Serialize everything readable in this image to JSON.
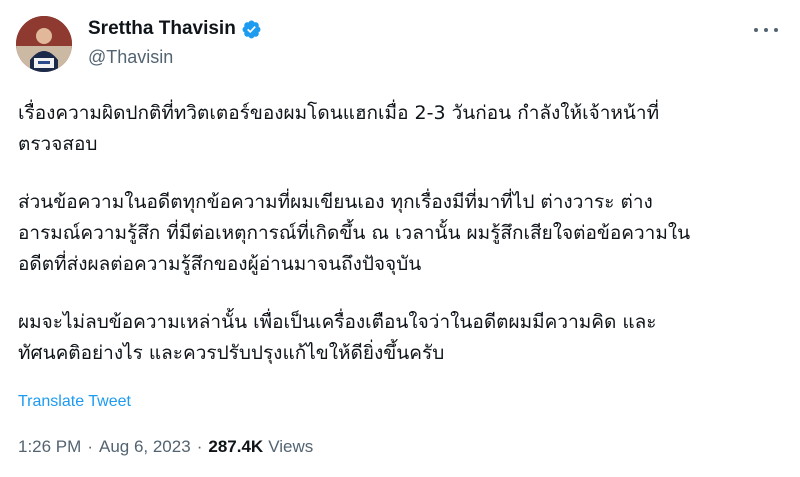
{
  "author": {
    "name": "Srettha Thavisin",
    "handle": "@Thavisin",
    "verified": true,
    "avatar_colors": {
      "top": "#7a2b2b",
      "bottom": "#d8c9b8"
    }
  },
  "more_icon": "more-horizontal-icon",
  "paragraphs": [
    {
      "lines": [
        "เรื่องความผิดปกติที่ทวิตเตอร์ของผมโดนแฮกเมื่อ 2-3 วันก่อน กำลังให้เจ้าหน้าที่",
        "ตรวจสอบ"
      ]
    },
    {
      "lines": [
        "ส่วนข้อความในอดีตทุกข้อความที่ผมเขียนเอง ทุกเรื่องมีที่มาที่ไป ต่างวาระ ต่าง",
        "อารมณ์ความรู้สึก ที่มีต่อเหตุการณ์ที่เกิดขึ้น ณ เวลานั้น ผมรู้สึกเสียใจต่อข้อความใน",
        "อดีตที่ส่งผลต่อความรู้สึกของผู้อ่านมาจนถึงปัจจุบัน"
      ]
    },
    {
      "lines": [
        "ผมจะไม่ลบข้อความเหล่านั้น เพื่อเป็นเครื่องเตือนใจว่าในอดีตผมมีความคิด และ",
        "ทัศนคติอย่างไร และควรปรับปรุงแก้ไขให้ดียิ่งขึ้นครับ"
      ]
    }
  ],
  "translate_label": "Translate Tweet",
  "meta": {
    "time": "1:26 PM",
    "separator": "·",
    "date": "Aug 6, 2023",
    "views_count": "287.4K",
    "views_label": "Views"
  },
  "colors": {
    "text": "#0f1419",
    "secondary": "#536471",
    "link": "#1d9bf0",
    "verified": "#1d9bf0"
  }
}
